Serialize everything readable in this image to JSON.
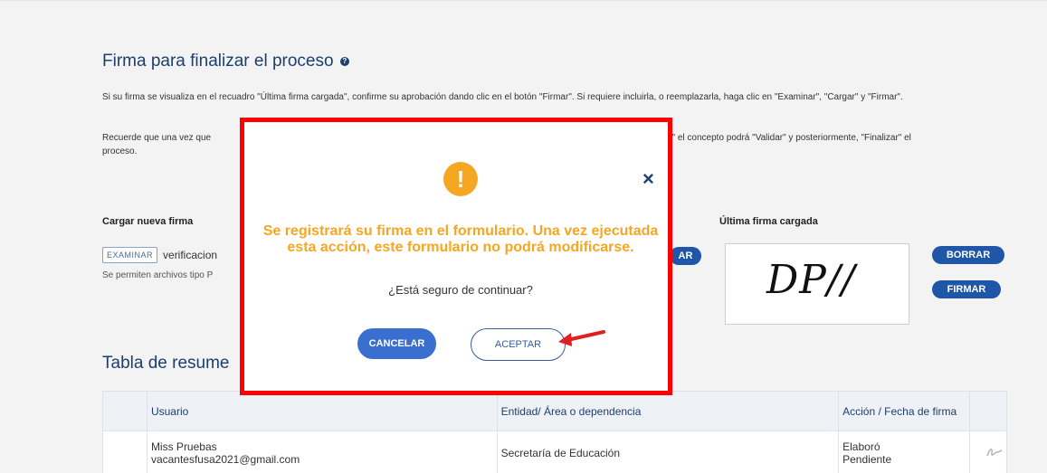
{
  "section": {
    "title": "Firma para finalizar el proceso",
    "help_icon": "?",
    "paragraph1": "Si su firma se visualiza en el recuadro \"Última firma cargada\", confirme su aprobación dando clic en el botón \"Firmar\". Si requiere incluirla, o reemplazarla, haga clic en \"Examinar\", \"Cargar\" y \"Firmar\".",
    "paragraph2_left": "Recuerde que una vez que",
    "paragraph2_right": "mitir\" el concepto podrá \"Validar\" y posteriormente, \"Finalizar\" el",
    "paragraph2_end": "proceso."
  },
  "upload": {
    "label": "Cargar nueva firma",
    "examinar_label": "EXAMINAR",
    "file_name": "verificacion",
    "hint": "Se permiten archivos tipo P",
    "cargar_partial": "AR"
  },
  "last_signature": {
    "label": "Última firma cargada",
    "signature_text": "DP//",
    "borrar_label": "BORRAR",
    "firmar_label": "FIRMAR"
  },
  "table": {
    "title": "Tabla de resume",
    "headers": [
      "Usuario",
      "Entidad/ Área o dependencia",
      "Acción / Fecha de firma"
    ],
    "rows": [
      {
        "user_name": "Miss Pruebas",
        "user_email": "vacantesfusa2021@gmail.com",
        "entity": "Secretaría de Educación",
        "action": "Elaboró",
        "date": "Pendiente",
        "action_icon": "signature-icon"
      }
    ]
  },
  "modal": {
    "warning_icon": "!",
    "close_icon": "×",
    "message": "Se registrará su firma en el formulario. Una vez ejecutada esta acción, este formulario no podrá modificarse.",
    "question": "¿Está seguro de continuar?",
    "cancel_label": "CANCELAR",
    "accept_label": "ACEPTAR"
  },
  "colors": {
    "highlight_border": "#ff0000",
    "warning": "#f5a623",
    "primary": "#1f56a8",
    "title": "#1c3f6e"
  }
}
